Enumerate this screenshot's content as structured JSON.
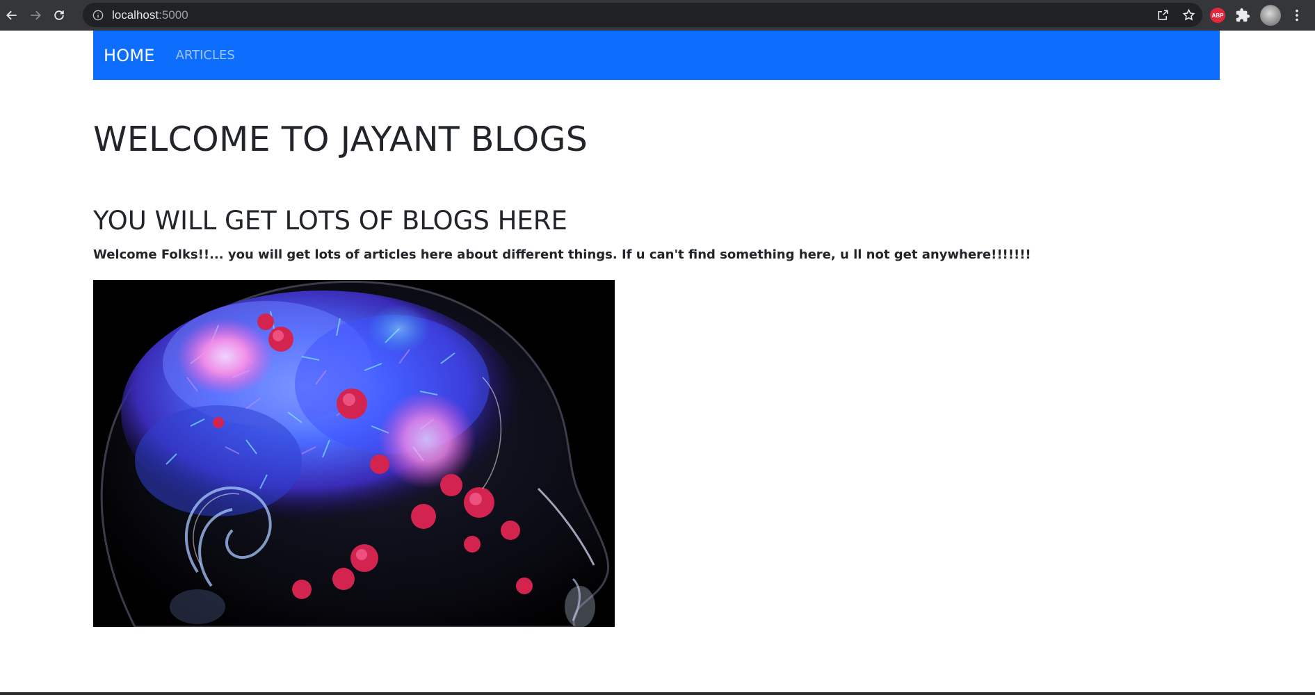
{
  "browser": {
    "url_host": "localhost",
    "url_port": ":5000",
    "extension_label": "ABP"
  },
  "navbar": {
    "home_label": "HOME",
    "articles_label": "ARTICLES",
    "background": "#0d6efd"
  },
  "main": {
    "title": "WELCOME TO JAYANT BLOGS",
    "subtitle": "YOU WILL GET LOTS OF BLOGS HERE",
    "intro": "Welcome Folks!!... you will get lots of articles here about different things. If u can't find something here, u ll not get anywhere!!!!!!!"
  }
}
